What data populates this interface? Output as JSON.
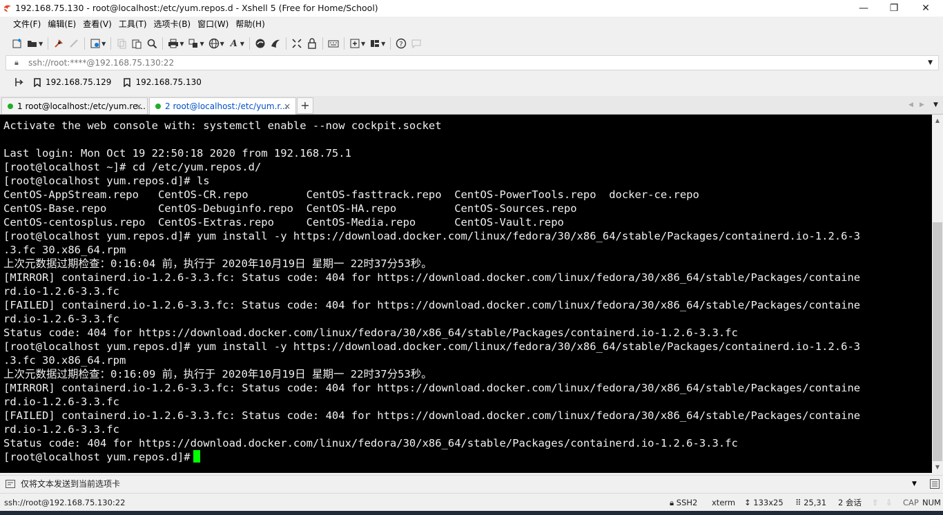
{
  "window": {
    "title": "192.168.75.130  - root@localhost:/etc/yum.repos.d - Xshell 5 (Free for Home/School)",
    "min": "—",
    "max": "❐",
    "close": "✕"
  },
  "menu": [
    "文件(F)",
    "编辑(E)",
    "查看(V)",
    "工具(T)",
    "选项卡(B)",
    "窗口(W)",
    "帮助(H)"
  ],
  "address": {
    "value": "ssh://root:****@192.168.75.130:22",
    "dropdown": "▼"
  },
  "links": [
    "192.168.75.129",
    "192.168.75.130"
  ],
  "tabs": [
    {
      "label": "1 root@localhost:/etc/yum.re...",
      "close": "×"
    },
    {
      "label": "2 root@localhost:/etc/yum.r...",
      "close": "×"
    }
  ],
  "tab_add": "+",
  "tab_nav": {
    "prev": "◀",
    "next": "▶",
    "menu": "▼"
  },
  "terminal": {
    "lines": [
      "Activate the web console with: systemctl enable --now cockpit.socket",
      "",
      "Last login: Mon Oct 19 22:50:18 2020 from 192.168.75.1",
      "[root@localhost ~]# cd /etc/yum.repos.d/",
      "[root@localhost yum.repos.d]# ls",
      "CentOS-AppStream.repo   CentOS-CR.repo         CentOS-fasttrack.repo  CentOS-PowerTools.repo  docker-ce.repo",
      "CentOS-Base.repo        CentOS-Debuginfo.repo  CentOS-HA.repo         CentOS-Sources.repo",
      "CentOS-centosplus.repo  CentOS-Extras.repo     CentOS-Media.repo      CentOS-Vault.repo",
      "[root@localhost yum.repos.d]# yum install -y https://download.docker.com/linux/fedora/30/x86_64/stable/Packages/containerd.io-1.2.6-3",
      ".3.fc 30.x86_64.rpm",
      "上次元数据过期检查：0:16:04 前，执行于 2020年10月19日 星期一 22时37分53秒。",
      "[MIRROR] containerd.io-1.2.6-3.3.fc: Status code: 404 for https://download.docker.com/linux/fedora/30/x86_64/stable/Packages/containe",
      "rd.io-1.2.6-3.3.fc",
      "[FAILED] containerd.io-1.2.6-3.3.fc: Status code: 404 for https://download.docker.com/linux/fedora/30/x86_64/stable/Packages/containe",
      "rd.io-1.2.6-3.3.fc",
      "Status code: 404 for https://download.docker.com/linux/fedora/30/x86_64/stable/Packages/containerd.io-1.2.6-3.3.fc",
      "[root@localhost yum.repos.d]# yum install -y https://download.docker.com/linux/fedora/30/x86_64/stable/Packages/containerd.io-1.2.6-3",
      ".3.fc 30.x86_64.rpm",
      "上次元数据过期检查：0:16:09 前，执行于 2020年10月19日 星期一 22时37分53秒。",
      "[MIRROR] containerd.io-1.2.6-3.3.fc: Status code: 404 for https://download.docker.com/linux/fedora/30/x86_64/stable/Packages/containe",
      "rd.io-1.2.6-3.3.fc",
      "[FAILED] containerd.io-1.2.6-3.3.fc: Status code: 404 for https://download.docker.com/linux/fedora/30/x86_64/stable/Packages/containe",
      "rd.io-1.2.6-3.3.fc",
      "Status code: 404 for https://download.docker.com/linux/fedora/30/x86_64/stable/Packages/containerd.io-1.2.6-3.3.fc"
    ],
    "prompt": "[root@localhost yum.repos.d]#",
    "cursor_color": "#00ff00",
    "background": "#000000",
    "foreground": "#f0f0f0"
  },
  "sendbar": {
    "text": "仅将文本发送到当前选项卡",
    "dropdown": "▼"
  },
  "status": {
    "connection": "ssh://root@192.168.75.130:22",
    "protocol": "SSH2",
    "term": "xterm",
    "size": "133x25",
    "position": "25,31",
    "sessions": "2 会话",
    "caps": "CAP",
    "num": "NUM"
  },
  "icons": {
    "app": "xshell-logo-icon",
    "toolbar": [
      "new-session-icon",
      "open-folder-icon",
      "reconnect-icon",
      "disconnect-icon",
      "properties-icon",
      "copy-icon",
      "paste-icon",
      "find-icon",
      "print-icon",
      "transfer-icon",
      "globe-icon",
      "font-icon",
      "xftp-icon",
      "xmanager-icon",
      "fullscreen-icon",
      "lock-icon",
      "keyboard-icon",
      "new-tab-icon",
      "layout-icon",
      "help-icon",
      "chat-icon"
    ]
  }
}
